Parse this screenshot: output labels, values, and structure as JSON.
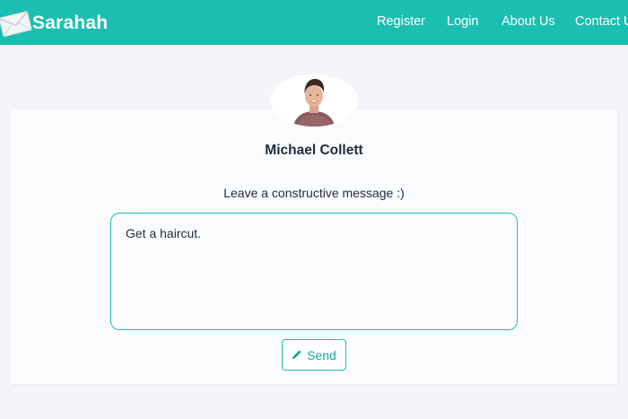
{
  "navbar": {
    "brand": "Sarahah",
    "logo_icon": "envelope-icon",
    "links": [
      {
        "label": "Register"
      },
      {
        "label": "Login"
      },
      {
        "label": "About Us"
      },
      {
        "label": "Contact Us"
      }
    ],
    "color": "#1bbfb2"
  },
  "profile": {
    "name": "Michael Collett",
    "avatar": "profile-photo"
  },
  "form": {
    "prompt": "Leave a constructive message :)",
    "message_value": "Get a haircut.",
    "send_label": "Send",
    "send_icon": "pencil-icon"
  }
}
